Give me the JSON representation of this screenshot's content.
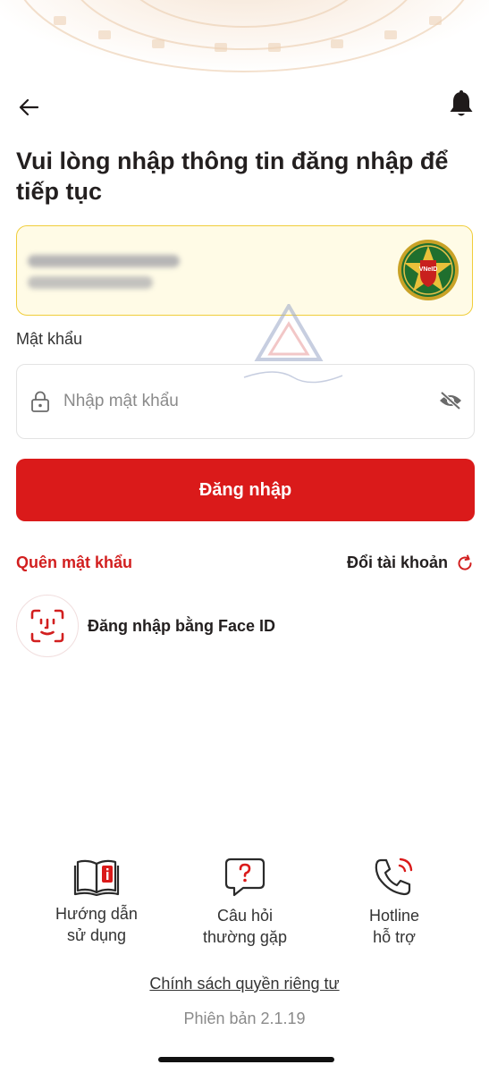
{
  "header": {
    "title": "Vui lòng nhập thông tin đăng nhập để tiếp tục"
  },
  "account_card": {
    "logo_text": "VNeID"
  },
  "password": {
    "label": "Mật khẩu",
    "placeholder": "Nhập mật khẩu",
    "value": ""
  },
  "login_button": "Đăng nhập",
  "links": {
    "forgot_password": "Quên mật khẩu",
    "switch_account": "Đổi tài khoản"
  },
  "face_id": {
    "label": "Đăng nhập bằng Face ID"
  },
  "footer": {
    "items": [
      {
        "line1": "Hướng dẫn",
        "line2": "sử dụng",
        "icon": "book-icon"
      },
      {
        "line1": "Câu hỏi",
        "line2": "thường gặp",
        "icon": "question-bubble-icon"
      },
      {
        "line1": "Hotline",
        "line2": "hỗ trợ",
        "icon": "phone-icon"
      }
    ],
    "privacy": "Chính sách quyền riêng tư",
    "version": "Phiên bản 2.1.19"
  },
  "colors": {
    "primary": "#da1a1a",
    "card_border": "#f0cd3a",
    "card_bg": "#fffbe6"
  }
}
